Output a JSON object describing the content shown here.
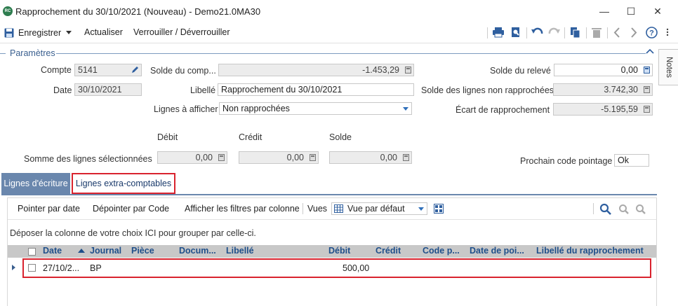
{
  "window": {
    "app_icon": "RC",
    "title": "Rapprochement du 30/10/2021 (Nouveau) - Demo21.0MA30",
    "minimize": "—",
    "maximize": "☐",
    "close": "✕"
  },
  "toolbar": {
    "save_label": "Enregistrer",
    "refresh_label": "Actualiser",
    "lock_label": "Verrouiller / Déverrouiller"
  },
  "section": {
    "title": "Paramètres"
  },
  "notes_tab": {
    "label": "Notes"
  },
  "form": {
    "compte_label": "Compte",
    "compte_value": "5141",
    "date_label": "Date",
    "date_value": "30/10/2021",
    "solde_compte_label": "Solde du comp...",
    "solde_compte_value": "-1.453,29",
    "libelle_label": "Libellé",
    "libelle_value": "Rapprochement du 30/10/2021",
    "lignes_label": "Lignes à afficher",
    "lignes_value": "Non rapprochées",
    "solde_releve_label": "Solde du relevé",
    "solde_releve_value": "0,00",
    "solde_non_rapp_label": "Solde des lignes non rapprochées",
    "solde_non_rapp_value": "3.742,30",
    "ecart_label": "Écart de rapprochement",
    "ecart_value": "-5.195,59",
    "debit_header": "Débit",
    "credit_header": "Crédit",
    "solde_header": "Solde",
    "somme_label": "Somme des lignes sélectionnées",
    "somme_debit": "0,00",
    "somme_credit": "0,00",
    "somme_solde": "0,00",
    "prochain_label": "Prochain code pointage",
    "prochain_value": "Ok"
  },
  "tabs": [
    {
      "label": "Lignes d'écriture"
    },
    {
      "label": "Lignes extra-comptables"
    }
  ],
  "grid_toolbar": {
    "pointer_label": "Pointer par date",
    "depointer_label": "Dépointer par Code",
    "filters_label": "Afficher les filtres par colonne",
    "vues_label": "Vues",
    "view_value": "Vue par défaut"
  },
  "grid": {
    "dropzone_text": "Déposer la colonne de votre choix ICI pour grouper par celle-ci.",
    "columns": [
      "Date",
      "Journal",
      "Pièce",
      "Docum...",
      "Libellé",
      "Débit",
      "Crédit",
      "Code p...",
      "Date de poi...",
      "Libellé du rapprochement"
    ],
    "rows": [
      {
        "date": "27/10/2...",
        "journal": "BP",
        "debit": "500,00"
      }
    ]
  },
  "colors": {
    "accent": "#2f6fba",
    "tab_active": "#6a87ad",
    "highlight_red": "#d9232e",
    "header_text": "#1f4f8a"
  }
}
